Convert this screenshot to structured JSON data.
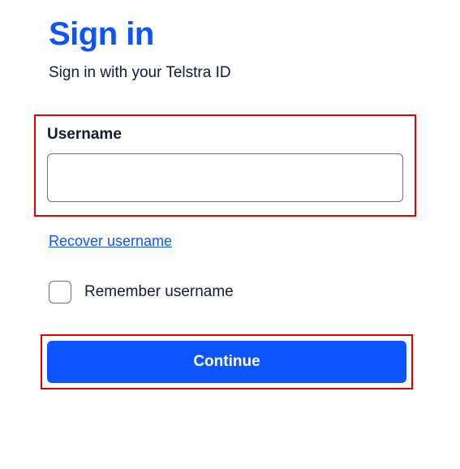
{
  "title": "Sign in",
  "subtitle": "Sign in with your Telstra ID",
  "form": {
    "username_label": "Username",
    "username_value": "",
    "recover_link": "Recover username",
    "remember_label": "Remember username",
    "remember_checked": false,
    "continue_label": "Continue"
  },
  "colors": {
    "accent": "#0D54FF",
    "highlight_border": "#E30000"
  }
}
